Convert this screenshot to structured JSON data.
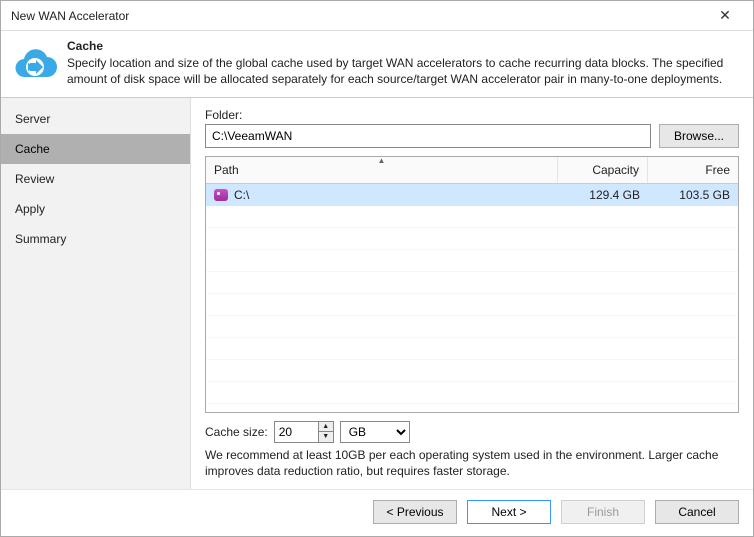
{
  "window": {
    "title": "New WAN Accelerator"
  },
  "header": {
    "title": "Cache",
    "description": "Specify location and size of the global cache used by target WAN accelerators to cache recurring data blocks. The specified amount of disk space will be allocated separately for each source/target WAN accelerator pair in many-to-one deployments."
  },
  "sidebar": {
    "steps": [
      {
        "label": "Server"
      },
      {
        "label": "Cache"
      },
      {
        "label": "Review"
      },
      {
        "label": "Apply"
      },
      {
        "label": "Summary"
      }
    ],
    "activeIndex": 1
  },
  "folder": {
    "label": "Folder:",
    "value": "C:\\VeeamWAN",
    "browse": "Browse..."
  },
  "table": {
    "cols": {
      "path": "Path",
      "capacity": "Capacity",
      "free": "Free"
    },
    "rows": [
      {
        "path": "C:\\",
        "capacity": "129.4 GB",
        "free": "103.5 GB"
      }
    ]
  },
  "cache": {
    "label": "Cache size:",
    "value": "20",
    "unit": "GB",
    "hint": "We recommend at least 10GB per each operating system used in the environment. Larger cache improves data reduction ratio, but requires faster storage."
  },
  "buttons": {
    "previous": "< Previous",
    "next": "Next >",
    "finish": "Finish",
    "cancel": "Cancel"
  }
}
